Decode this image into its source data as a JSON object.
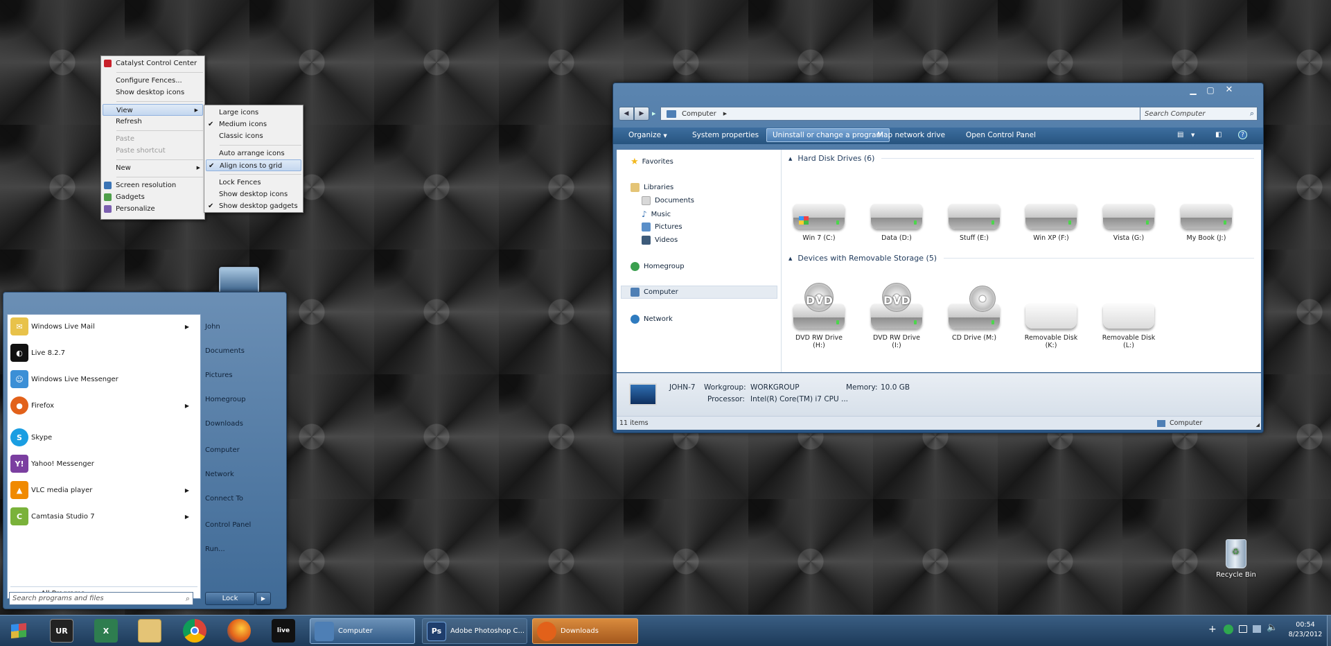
{
  "context_menu": {
    "items": [
      {
        "label": "Catalyst Control Center"
      },
      {
        "label": "Configure Fences..."
      },
      {
        "label": "Show desktop icons"
      },
      {
        "label": "View"
      },
      {
        "label": "Refresh"
      },
      {
        "label": "Paste"
      },
      {
        "label": "Paste shortcut"
      },
      {
        "label": "New"
      },
      {
        "label": "Screen resolution"
      },
      {
        "label": "Gadgets"
      },
      {
        "label": "Personalize"
      }
    ],
    "view_submenu": [
      {
        "label": "Large icons"
      },
      {
        "label": "Medium icons"
      },
      {
        "label": "Classic icons"
      },
      {
        "label": "Auto arrange icons"
      },
      {
        "label": "Align icons to grid"
      },
      {
        "label": "Lock Fences"
      },
      {
        "label": "Show desktop icons"
      },
      {
        "label": "Show desktop gadgets"
      }
    ],
    "checked": [
      "Medium icons",
      "Align icons to grid",
      "Show desktop gadgets"
    ]
  },
  "start_menu": {
    "programs": [
      {
        "label": "Windows Live Mail",
        "icon": "mail-icon",
        "color": "#e8c24a",
        "has_submenu": true
      },
      {
        "label": "Live 8.2.7",
        "icon": "live-icon",
        "color": "#111111",
        "has_submenu": false
      },
      {
        "label": "Windows Live Messenger",
        "icon": "messenger-icon",
        "color": "#3b8fd6",
        "has_submenu": false
      },
      {
        "label": "Firefox",
        "icon": "firefox-icon",
        "color": "#e2611a",
        "has_submenu": true
      },
      {
        "label": "Skype",
        "icon": "skype-icon",
        "color": "#1a9ee2",
        "has_submenu": false
      },
      {
        "label": "Yahoo! Messenger",
        "icon": "yahoo-icon",
        "color": "#7b3fa0",
        "has_submenu": false
      },
      {
        "label": "VLC media player",
        "icon": "vlc-icon",
        "color": "#f08a00",
        "has_submenu": true
      },
      {
        "label": "Camtasia Studio 7",
        "icon": "camtasia-icon",
        "color": "#7ab23a",
        "has_submenu": true
      }
    ],
    "all_programs": "All Programs",
    "right_items": [
      {
        "label": "John"
      },
      {
        "label": "Documents"
      },
      {
        "label": "Pictures"
      },
      {
        "label": "Homegroup"
      },
      {
        "label": "Downloads"
      },
      {
        "label": "Computer"
      },
      {
        "label": "Network"
      },
      {
        "label": "Connect To"
      },
      {
        "label": "Control Panel"
      },
      {
        "label": "Run..."
      }
    ],
    "search_placeholder": "Search programs and files",
    "lock_label": "Lock"
  },
  "explorer": {
    "breadcrumb": "Computer",
    "search_placeholder": "Search Computer",
    "toolbar": {
      "organize": "Organize",
      "system_properties": "System properties",
      "uninstall": "Uninstall or change a program",
      "map_drive": "Map network drive",
      "control_panel": "Open Control Panel"
    },
    "nav": [
      {
        "label": "Favorites",
        "icon": "star-icon",
        "color": "#f2b81e"
      },
      {
        "label": "Libraries",
        "icon": "libraries-icon",
        "color": "#e4c476"
      },
      {
        "label": "Documents",
        "icon": "documents-icon",
        "color": "#d8d8d8"
      },
      {
        "label": "Music",
        "icon": "music-icon",
        "color": "#3a74b5"
      },
      {
        "label": "Pictures",
        "icon": "pictures-icon",
        "color": "#5a8fc9"
      },
      {
        "label": "Videos",
        "icon": "videos-icon",
        "color": "#3d5b7a"
      },
      {
        "label": "Homegroup",
        "icon": "homegroup-icon",
        "color": "#3a9f4e"
      },
      {
        "label": "Computer",
        "icon": "computer-icon",
        "color": "#4e7fb5"
      },
      {
        "label": "Network",
        "icon": "network-icon",
        "color": "#2f7bbf"
      }
    ],
    "hdd_group": "Hard Disk Drives (6)",
    "hdd": [
      {
        "label": "Win 7 (C:)"
      },
      {
        "label": "Data (D:)"
      },
      {
        "label": "Stuff (E:)"
      },
      {
        "label": "Win XP (F:)"
      },
      {
        "label": "Vista (G:)"
      },
      {
        "label": "My Book (J:)"
      }
    ],
    "removable_group": "Devices with Removable Storage (5)",
    "removable": [
      {
        "label": "DVD RW Drive (H:)",
        "badge": "DVD"
      },
      {
        "label": "DVD RW Drive (I:)",
        "badge": "DVD"
      },
      {
        "label": "CD Drive (M:)",
        "badge": ""
      },
      {
        "label": "Removable Disk (K:)",
        "badge": ""
      },
      {
        "label": "Removable Disk (L:)",
        "badge": ""
      }
    ],
    "details": {
      "name": "JOHN-7",
      "workgroup_label": "Workgroup:",
      "workgroup": "WORKGROUP",
      "memory_label": "Memory:",
      "memory": "10.0 GB",
      "processor_label": "Processor:",
      "processor": "Intel(R) Core(TM) i7 CPU   ..."
    },
    "status_items": "11 items",
    "status_location": "Computer"
  },
  "desktop": {
    "recycle_bin": "Recycle Bin"
  },
  "taskbar": {
    "pinned": [
      {
        "icon": "windows-start-icon",
        "text": "",
        "color": "#3a5e83"
      },
      {
        "icon": "ur-icon",
        "text": "UR",
        "color": "#222222"
      },
      {
        "icon": "excel-icon",
        "text": "X",
        "color": "#2e7d4f"
      },
      {
        "icon": "explorer-icon",
        "text": "",
        "color": "#e4c476"
      },
      {
        "icon": "chrome-icon",
        "text": "",
        "color": "#4caf50"
      },
      {
        "icon": "firefox-icon",
        "text": "",
        "color": "#e2611a"
      },
      {
        "icon": "live-icon",
        "text": "live",
        "color": "#111111"
      }
    ],
    "windows": [
      {
        "label": "Computer",
        "icon": "computer-icon",
        "color": "#4e7fb5",
        "active": true
      },
      {
        "label": "Adobe Photoshop C...",
        "icon": "photoshop-icon",
        "color": "#1f3e6c",
        "active": false
      },
      {
        "label": "Downloads",
        "icon": "firefox-icon",
        "color": "#e2611a",
        "active": false,
        "highlighted": true
      }
    ],
    "clock_time": "00:54",
    "clock_date": "8/23/2012"
  }
}
